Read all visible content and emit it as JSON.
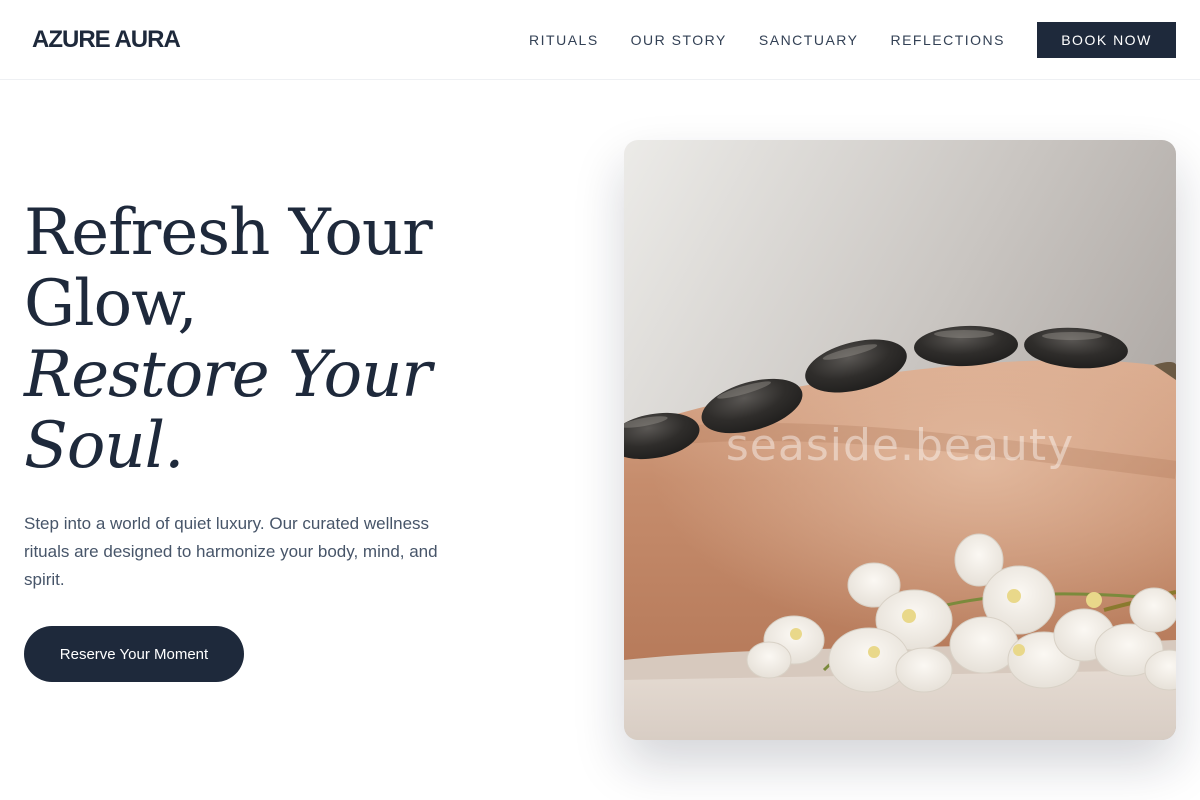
{
  "header": {
    "logo": "AZURE AURA",
    "nav": [
      "RITUALS",
      "OUR STORY",
      "SANCTUARY",
      "REFLECTIONS"
    ],
    "cta": "BOOK NOW"
  },
  "hero": {
    "title_line1": "Refresh Your",
    "title_line2": "Glow,",
    "title_line3": "Restore Your",
    "title_line4": "Soul.",
    "description": "Step into a world of quiet luxury. Our curated wellness rituals are designed to harmonize your body, mind, and spirit.",
    "cta": "Reserve Your Moment"
  },
  "image": {
    "subject": "hot-stone-massage-photo",
    "watermark": "seaside.beauty"
  },
  "colors": {
    "primary": "#1e293b",
    "text_muted": "#475569",
    "background": "#ffffff"
  }
}
